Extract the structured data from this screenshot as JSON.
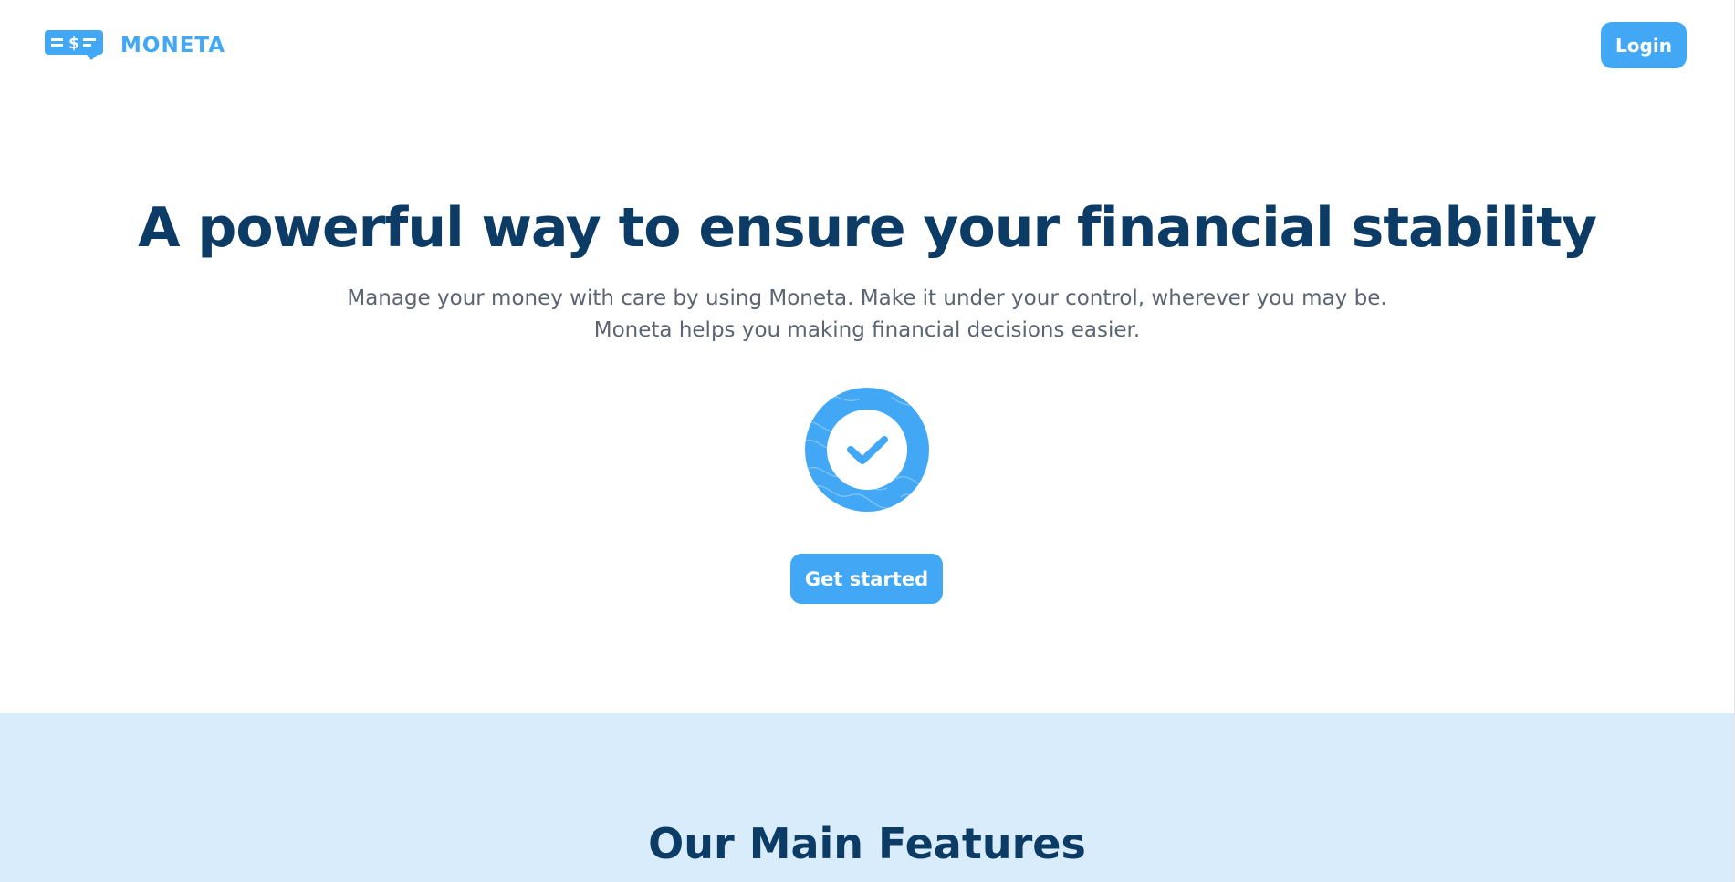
{
  "header": {
    "brand_name": "MONETA",
    "login_label": "Login"
  },
  "hero": {
    "title": "A powerful way to ensure your financial stability",
    "subtitle_line1": "Manage your money with care by using Moneta. Make it under your control, wherever you may be.",
    "subtitle_line2": "Moneta helps you making financial decisions easier.",
    "badge_icon": "check-circle-icon",
    "cta_label": "Get started"
  },
  "features": {
    "title": "Our Main Features"
  },
  "colors": {
    "accent": "#42a8f5",
    "heading": "#0c3c66",
    "body_text": "#5b6472",
    "features_bg": "#d8ecfb",
    "background": "#ffffff"
  }
}
